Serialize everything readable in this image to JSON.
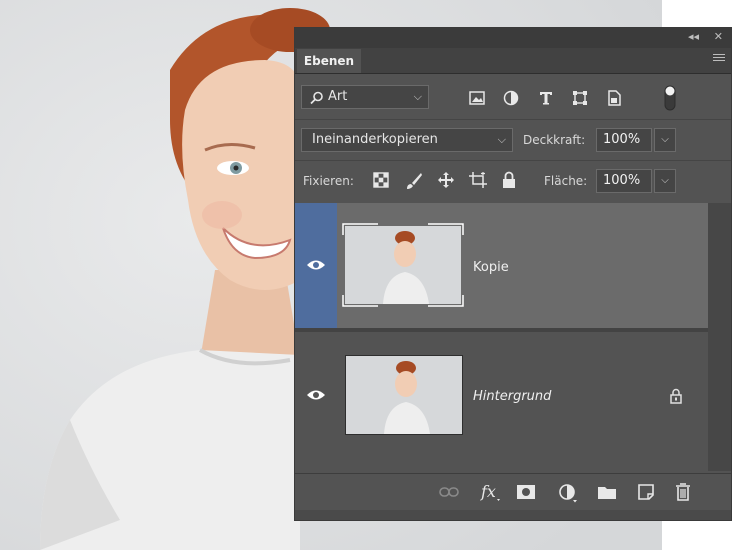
{
  "panel": {
    "collapse_glyph": "◂◂",
    "close_glyph": "✕",
    "tab_label": "Ebenen",
    "menu_icon": "hamburger-menu-icon"
  },
  "filter": {
    "kind_label": "Art",
    "icons": [
      "image-filter-icon",
      "adjustment-filter-icon",
      "type-filter-icon",
      "shape-filter-icon",
      "smart-object-filter-icon",
      "filter-toggle-icon"
    ]
  },
  "blend": {
    "mode": "Ineinanderkopieren",
    "opacity_label": "Deckkraft:",
    "opacity_value": "100%"
  },
  "lock": {
    "label": "Fixieren:",
    "icons": [
      "lock-transparent-pixels-icon",
      "lock-image-pixels-icon",
      "lock-position-icon",
      "lock-artboard-icon",
      "lock-all-icon"
    ],
    "fill_label": "Fläche:",
    "fill_value": "100%"
  },
  "layers": [
    {
      "name": "Kopie",
      "visible": true,
      "selected": true,
      "locked": false
    },
    {
      "name": "Hintergrund",
      "visible": true,
      "selected": false,
      "locked": true
    }
  ],
  "bottom_icons": [
    "link-layers-icon",
    "fx-icon",
    "add-mask-icon",
    "adjustment-layer-icon",
    "new-group-icon",
    "new-layer-icon",
    "trash-icon"
  ],
  "colors": {
    "panel_bg": "#535353",
    "selected_layer": "#6b6b6b",
    "selected_eye_column": "#4f6d9e"
  }
}
